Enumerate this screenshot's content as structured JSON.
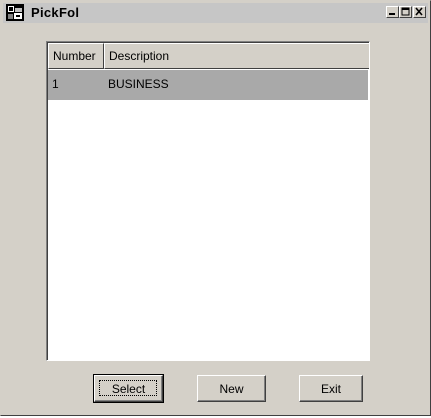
{
  "window": {
    "title": "PickFol"
  },
  "titlebar_buttons": {
    "minimize": "minimize-icon",
    "maximize": "maximize-icon",
    "close": "close-icon"
  },
  "list": {
    "columns": [
      "Number",
      "Description"
    ],
    "rows": [
      {
        "number": "1",
        "description": "BUSINESS",
        "selected": true
      }
    ],
    "selected_row_color": "#a9a9a9"
  },
  "buttons": {
    "select": "Select",
    "new": "New",
    "exit": "Exit"
  }
}
